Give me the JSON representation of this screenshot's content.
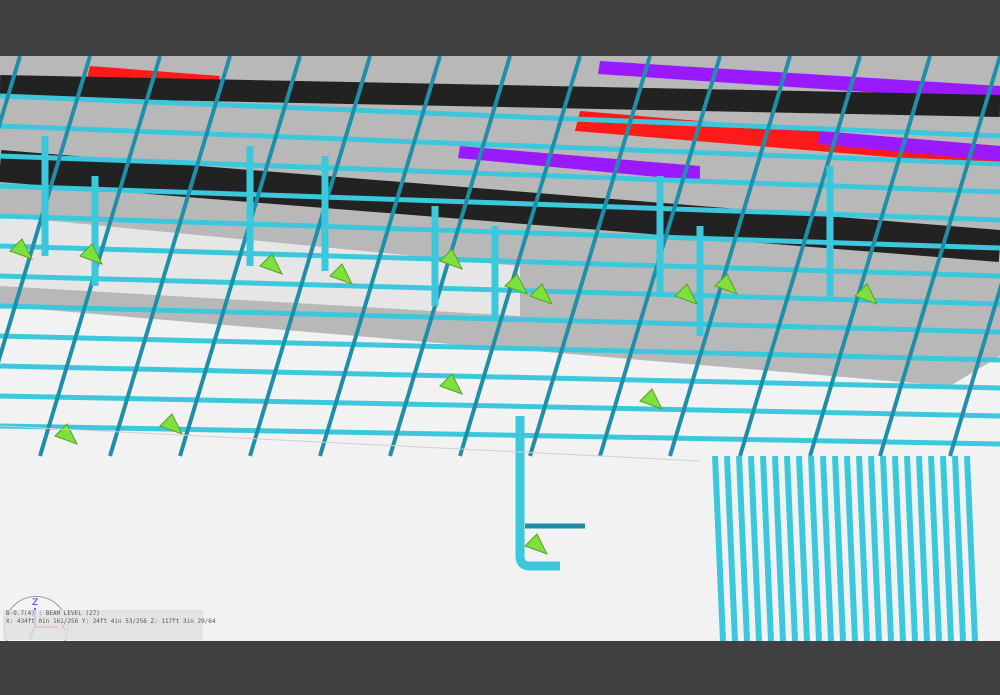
{
  "view": {
    "name": "3D model view of overhead piping and sprinkler layout"
  },
  "colors": {
    "pipe": "#3cc8dc",
    "pipe_dark": "#1f8fa8",
    "valve": "#7ee03c",
    "duct_black": "#222222",
    "band_red": "#ff1a1a",
    "band_purple": "#9a1aff",
    "ceiling_gray": "#b8b8b8",
    "floor": "#f2f2f2",
    "frame": "#404040"
  },
  "compass": {
    "z_label": "Z",
    "x_label": "X",
    "y_label": "Y"
  },
  "status": {
    "line1": "B-9.7(4) : BEAM LEVEL (27)",
    "line2": "X: 434ft 0in 161/256   Y: 24ft 4in 53/256   Z: 117ft 3in 29/64"
  }
}
